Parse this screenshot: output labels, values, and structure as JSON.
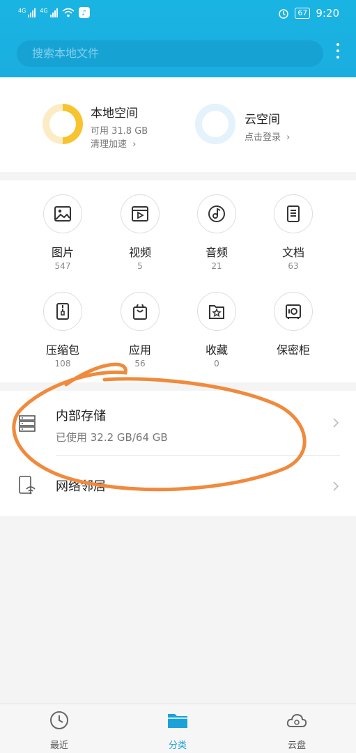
{
  "status_bar": {
    "sim1": "4G",
    "sim2": "4G",
    "battery": "67",
    "time": "9:20"
  },
  "search": {
    "placeholder": "搜索本地文件"
  },
  "storage": {
    "local": {
      "title": "本地空间",
      "available": "可用 31.8 GB",
      "action": "清理加速",
      "used_fraction": 0.5
    },
    "cloud": {
      "title": "云空间",
      "action": "点击登录"
    }
  },
  "categories": [
    {
      "label": "图片",
      "count": "547",
      "icon": "image-icon"
    },
    {
      "label": "视频",
      "count": "5",
      "icon": "video-icon"
    },
    {
      "label": "音频",
      "count": "21",
      "icon": "audio-icon"
    },
    {
      "label": "文档",
      "count": "63",
      "icon": "document-icon"
    },
    {
      "label": "压缩包",
      "count": "108",
      "icon": "archive-icon"
    },
    {
      "label": "应用",
      "count": "56",
      "icon": "app-bag-icon"
    },
    {
      "label": "收藏",
      "count": "0",
      "icon": "favorite-star-icon"
    },
    {
      "label": "保密柜",
      "count": "",
      "icon": "safe-icon"
    }
  ],
  "locations": [
    {
      "title": "内部存储",
      "subtitle": "已使用 32.2 GB/64 GB",
      "icon": "internal-storage-icon"
    },
    {
      "title": "网络邻居",
      "subtitle": "",
      "icon": "network-neighbor-icon"
    }
  ],
  "bottom_nav": [
    {
      "label": "最近",
      "icon": "clock-icon",
      "active": false
    },
    {
      "label": "分类",
      "icon": "folder-icon",
      "active": true
    },
    {
      "label": "云盘",
      "icon": "cloud-icon",
      "active": false
    }
  ],
  "colors": {
    "header": "#1aaee0",
    "accent": "#1aa2d8",
    "local_ring": "#f7c32e",
    "annotation": "#f08a3c"
  }
}
